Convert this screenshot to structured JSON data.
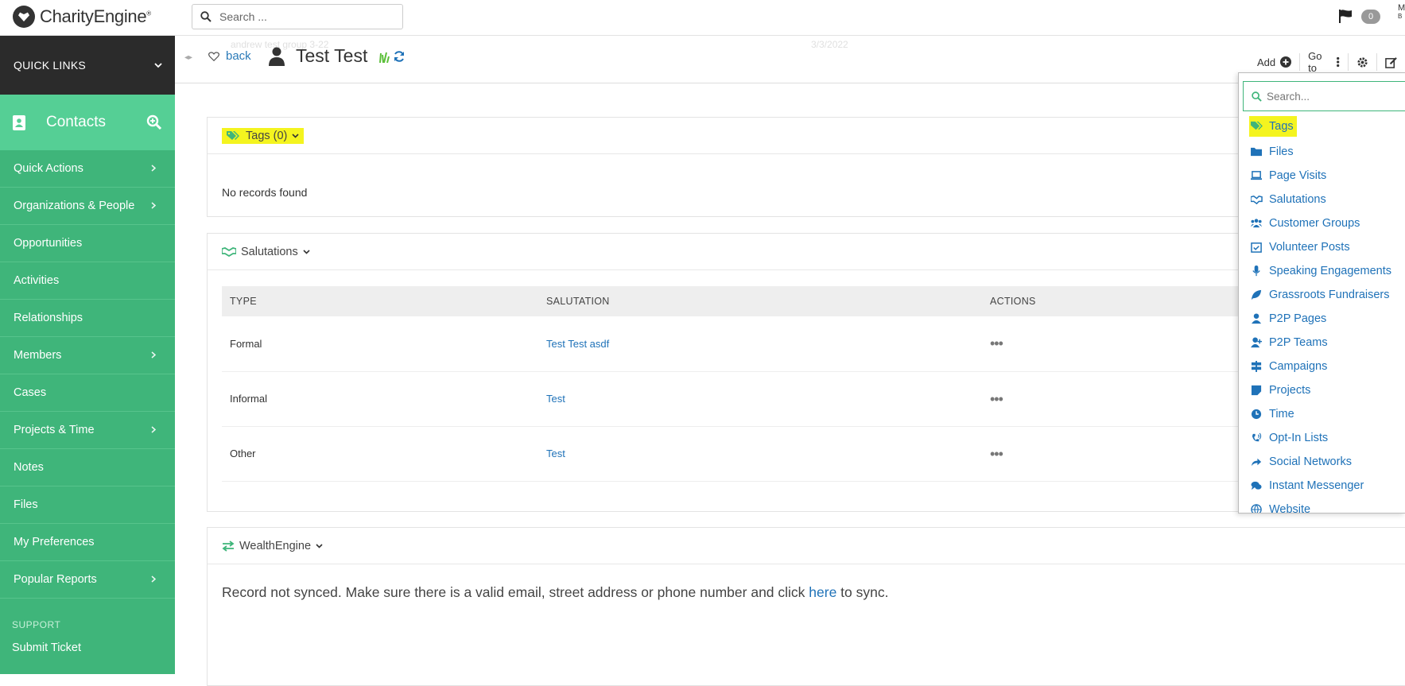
{
  "top": {
    "logo_text": "CharityEngine",
    "logo_reg": "®",
    "search_placeholder": "Search ...",
    "notifications_count": "0",
    "user_initial": "M",
    "user_sub": "B"
  },
  "sidebar": {
    "quick_links": "QUICK LINKS",
    "section": "Contacts",
    "items": [
      {
        "label": "Quick Actions",
        "chevron": true
      },
      {
        "label": "Organizations & People",
        "chevron": true
      },
      {
        "label": "Opportunities",
        "chevron": false
      },
      {
        "label": "Activities",
        "chevron": false
      },
      {
        "label": "Relationships",
        "chevron": false
      },
      {
        "label": "Members",
        "chevron": true
      },
      {
        "label": "Cases",
        "chevron": false
      },
      {
        "label": "Projects & Time",
        "chevron": true
      },
      {
        "label": "Notes",
        "chevron": false
      },
      {
        "label": "Files",
        "chevron": false
      },
      {
        "label": "My Preferences",
        "chevron": false
      },
      {
        "label": "Popular Reports",
        "chevron": true
      }
    ],
    "support_label": "SUPPORT",
    "submit_ticket": "Submit Ticket"
  },
  "header": {
    "back": "back",
    "ghost_group": "andrew test group 3-22",
    "ghost_date": "3/3/2022",
    "contact_name": "Test Test",
    "add": "Add",
    "goto": "Go to"
  },
  "tags_panel": {
    "title": "Tags (0)",
    "empty": "No records found"
  },
  "salutations_panel": {
    "title": "Salutations",
    "columns": [
      "TYPE",
      "SALUTATION",
      "ACTIONS"
    ],
    "rows": [
      {
        "type": "Formal",
        "salutation": "Test Test asdf"
      },
      {
        "type": "Informal",
        "salutation": "Test"
      },
      {
        "type": "Other",
        "salutation": "Test"
      }
    ]
  },
  "wealth_panel": {
    "title": "WealthEngine",
    "text_before": "Record not synced. Make sure there is a valid email, street address or phone number and click ",
    "link": "here",
    "text_after": " to sync."
  },
  "dropdown": {
    "search_placeholder": "Search...",
    "items": [
      {
        "label": "Tags",
        "icon": "tags-icon"
      },
      {
        "label": "Files",
        "icon": "folder-icon"
      },
      {
        "label": "Page Visits",
        "icon": "laptop-icon"
      },
      {
        "label": "Salutations",
        "icon": "handshake-icon"
      },
      {
        "label": "Customer Groups",
        "icon": "users-icon"
      },
      {
        "label": "Volunteer Posts",
        "icon": "calendar-check-icon"
      },
      {
        "label": "Speaking Engagements",
        "icon": "microphone-icon"
      },
      {
        "label": "Grassroots Fundraisers",
        "icon": "leaf-icon"
      },
      {
        "label": "P2P Pages",
        "icon": "user-icon"
      },
      {
        "label": "P2P Teams",
        "icon": "user-plus-icon"
      },
      {
        "label": "Campaigns",
        "icon": "signpost-icon"
      },
      {
        "label": "Projects",
        "icon": "sticky-note-icon"
      },
      {
        "label": "Time",
        "icon": "clock-icon"
      },
      {
        "label": "Opt-In Lists",
        "icon": "phone-volume-icon"
      },
      {
        "label": "Social Networks",
        "icon": "share-icon"
      },
      {
        "label": "Instant Messenger",
        "icon": "comments-icon"
      },
      {
        "label": "Website",
        "icon": "globe-icon"
      }
    ]
  },
  "colors": {
    "sidebar_green": "#3fb57a",
    "contacts_green": "#55cf95",
    "link_blue": "#1f72b8",
    "highlight": "#f4f41f"
  }
}
